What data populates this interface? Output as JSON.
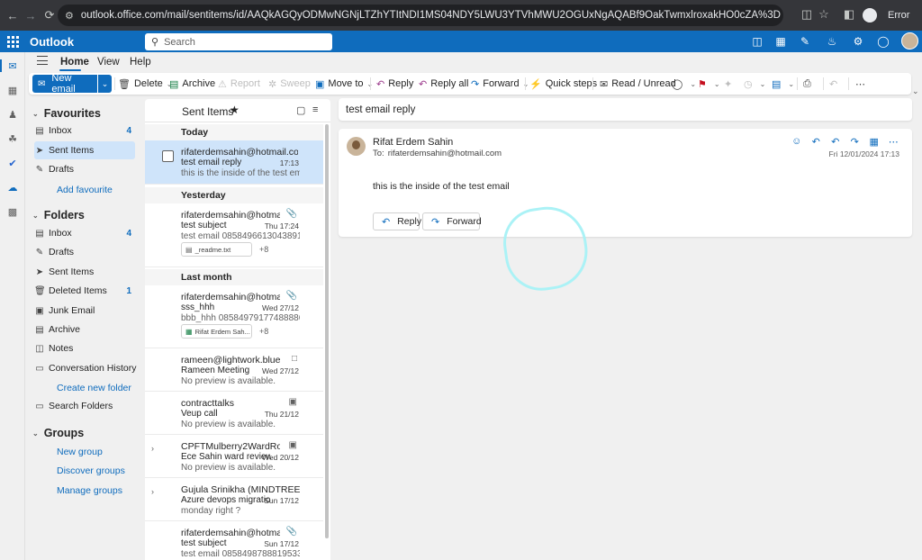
{
  "browser": {
    "url": "outlook.office.com/mail/sentitems/id/AAQkAGQyODMwNGNjLTZhYTItNDI1MS04NDY5LWU3YTVhMWU2OGUxNgAQABf9OakTwmxlroxakHO0cZA%3D",
    "error_label": "Error"
  },
  "header": {
    "app_title": "Outlook",
    "search_placeholder": "Search"
  },
  "menu": {
    "tabs": [
      "Home",
      "View",
      "Help"
    ],
    "active_tab": "Home"
  },
  "ribbon": {
    "new_mail": "New email",
    "delete": "Delete",
    "archive": "Archive",
    "report": "Report",
    "sweep": "Sweep",
    "move_to": "Move to",
    "reply": "Reply",
    "reply_all": "Reply all",
    "forward": "Forward",
    "quick_steps": "Quick steps",
    "read_unread": "Read / Unread"
  },
  "folders": {
    "favourites_label": "Favourites",
    "favourites": [
      {
        "label": "Inbox",
        "icon": "inbox-icon",
        "count": "4"
      },
      {
        "label": "Sent Items",
        "icon": "send-icon",
        "count": ""
      },
      {
        "label": "Drafts",
        "icon": "pencil-icon",
        "count": ""
      }
    ],
    "add_favourite": "Add favourite",
    "folders_label": "Folders",
    "items": [
      {
        "label": "Inbox",
        "icon": "inbox-icon",
        "count": "4"
      },
      {
        "label": "Drafts",
        "icon": "pencil-icon",
        "count": ""
      },
      {
        "label": "Sent Items",
        "icon": "send-icon",
        "count": ""
      },
      {
        "label": "Deleted Items",
        "icon": "trash-icon",
        "count": "1"
      },
      {
        "label": "Junk Email",
        "icon": "junk-icon",
        "count": ""
      },
      {
        "label": "Archive",
        "icon": "archive-icon",
        "count": ""
      },
      {
        "label": "Notes",
        "icon": "note-icon",
        "count": ""
      },
      {
        "label": "Conversation History",
        "icon": "folder-icon",
        "count": ""
      }
    ],
    "create_folder": "Create new folder",
    "search_folders": "Search Folders",
    "groups_label": "Groups",
    "group_links": [
      "New group",
      "Discover groups",
      "Manage groups"
    ]
  },
  "message_list": {
    "title": "Sent Items",
    "groups": {
      "today": "Today",
      "yesterday": "Yesterday",
      "last_month": "Last month"
    },
    "mails": [
      {
        "from": "rifaterdemsahin@hotmail.com",
        "subject": "test email reply",
        "date": "17:13",
        "preview": "this is the inside of the test email"
      },
      {
        "from": "rifaterdemsahin@hotmail.co...",
        "subject": "test subject",
        "date": "Thu 17:24",
        "preview": "test email 0858496613043891825...",
        "attachment": "_readme.txt",
        "more": "+8"
      },
      {
        "from": "rifaterdemsahin@hotmail.co...",
        "subject": "sss_hhh",
        "date": "Wed 27/12",
        "preview": "bbb_hhh 08584979177488886499...",
        "attachment": "Rifat Erdem Sah...",
        "more": "+8"
      },
      {
        "from": "rameen@lightwork.blue",
        "subject": "Rameen Meeting",
        "date": "Wed 27/12",
        "preview": "No preview is available."
      },
      {
        "from": "contracttalks",
        "subject": "Veup call",
        "date": "Thu 21/12",
        "preview": "No preview is available."
      },
      {
        "from": "CPFTMulberry2WardRounds",
        "subject": "Ece Sahin ward review",
        "date": "Wed 20/12",
        "preview": "No preview is available."
      },
      {
        "from": "Gujula Srinikha (MINDTREE LIMIT...",
        "subject": "Azure devops migratio...",
        "date": "Sun 17/12",
        "preview": "monday right ?"
      },
      {
        "from": "rifaterdemsahin@hotmail.co...",
        "subject": "test subject",
        "date": "Sun 17/12",
        "preview": "test email 0858498788819533754..."
      }
    ]
  },
  "reading_pane": {
    "subject": "test email reply",
    "sender": "Rifat Erdem Sahin",
    "to_label": "To:",
    "to": "rifaterdemsahin@hotmail.com",
    "date": "Fri 12/01/2024 17:13",
    "body": "this is the inside of the test email",
    "reply_button": "Reply",
    "forward_button": "Forward"
  },
  "colors": {
    "brand": "#0f6cbd",
    "selection": "#cfe4fa"
  }
}
